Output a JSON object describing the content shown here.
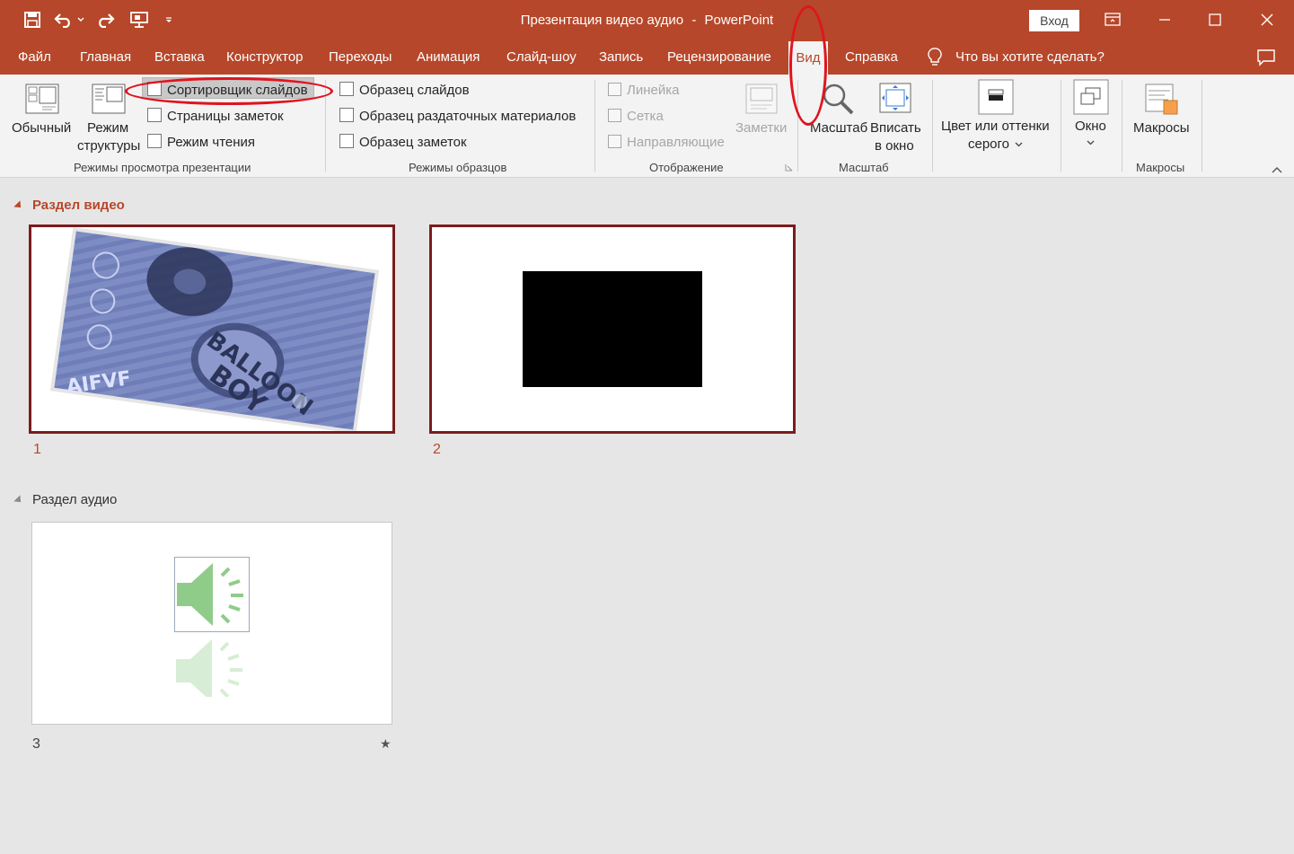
{
  "window": {
    "title": "Презентация видео аудио",
    "separator": "-",
    "app": "PowerPoint",
    "signin": "Вход"
  },
  "tabs": [
    "Файл",
    "Главная",
    "Вставка",
    "Конструктор",
    "Переходы",
    "Анимация",
    "Слайд-шоу",
    "Запись",
    "Рецензирование",
    "Вид",
    "Справка"
  ],
  "tellme": "Что вы хотите сделать?",
  "ribbon": {
    "views": {
      "normal": "Обычный",
      "outline_line1": "Режим",
      "outline_line2": "структуры",
      "sorter": "Сортировщик слайдов",
      "notes_page": "Страницы заметок",
      "reading": "Режим чтения",
      "group": "Режимы просмотра презентации"
    },
    "masters": {
      "slide": "Образец слайдов",
      "handout": "Образец раздаточных материалов",
      "notes": "Образец заметок",
      "group": "Режимы образцов"
    },
    "show": {
      "ruler": "Линейка",
      "grid": "Сетка",
      "guides": "Направляющие",
      "notes": "Заметки",
      "group": "Отображение"
    },
    "zoom": {
      "zoom": "Масштаб",
      "fit_line1": "Вписать",
      "fit_line2": "в окно",
      "group": "Масштаб"
    },
    "color": {
      "line1": "Цвет или оттенки",
      "line2": "серого"
    },
    "window": {
      "label": "Окно"
    },
    "macros": {
      "label": "Макросы",
      "group": "Макросы"
    }
  },
  "sections": [
    {
      "title": "Раздел видео",
      "slides": [
        {
          "number": "1",
          "text_top": "AIFVF",
          "poster_title_1": "BALLOON",
          "poster_title_2": "BOY"
        },
        {
          "number": "2"
        }
      ]
    },
    {
      "title": "Раздел аудио",
      "slides": [
        {
          "number": "3",
          "marker": "★"
        }
      ]
    }
  ],
  "colors": {
    "accent": "#b7472a",
    "selected_border": "#7b1c1c",
    "annotation": "#e0141e",
    "speaker": "#8fcc8a"
  },
  "icons": [
    "save-icon",
    "undo-icon",
    "redo-icon",
    "presenter-icon",
    "customize-icon",
    "restore-icon",
    "minimize-icon",
    "maximize-icon",
    "close-icon",
    "lightbulb-icon",
    "comments-icon",
    "collapse-ribbon-icon",
    "speaker-icon",
    "star-icon"
  ]
}
